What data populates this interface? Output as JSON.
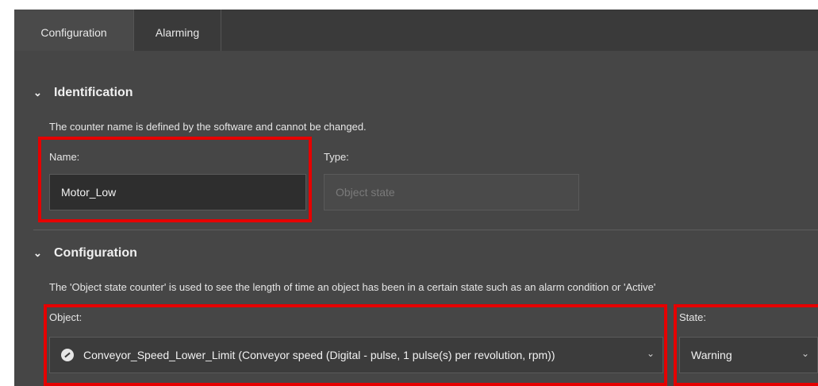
{
  "tabs": [
    {
      "label": "Configuration",
      "active": true
    },
    {
      "label": "Alarming",
      "active": false
    }
  ],
  "identification": {
    "title": "Identification",
    "description": "The counter name is defined by the software and cannot be changed.",
    "name_label": "Name:",
    "name_value": "Motor_Low",
    "type_label": "Type:",
    "type_placeholder": "Object state"
  },
  "configuration": {
    "title": "Configuration",
    "description": "The 'Object state counter' is used to see the length of time an object has been in a certain state such as an alarm condition or 'Active'",
    "object_label": "Object:",
    "object_value": "Conveyor_Speed_Lower_Limit (Conveyor speed (Digital - pulse, 1 pulse(s) per revolution, rpm))",
    "object_icon": "gauge-icon",
    "state_label": "State:",
    "state_value": "Warning"
  },
  "colors": {
    "highlight": "#e50000",
    "panel": "#464646",
    "tabbar": "#3a3a3a"
  }
}
